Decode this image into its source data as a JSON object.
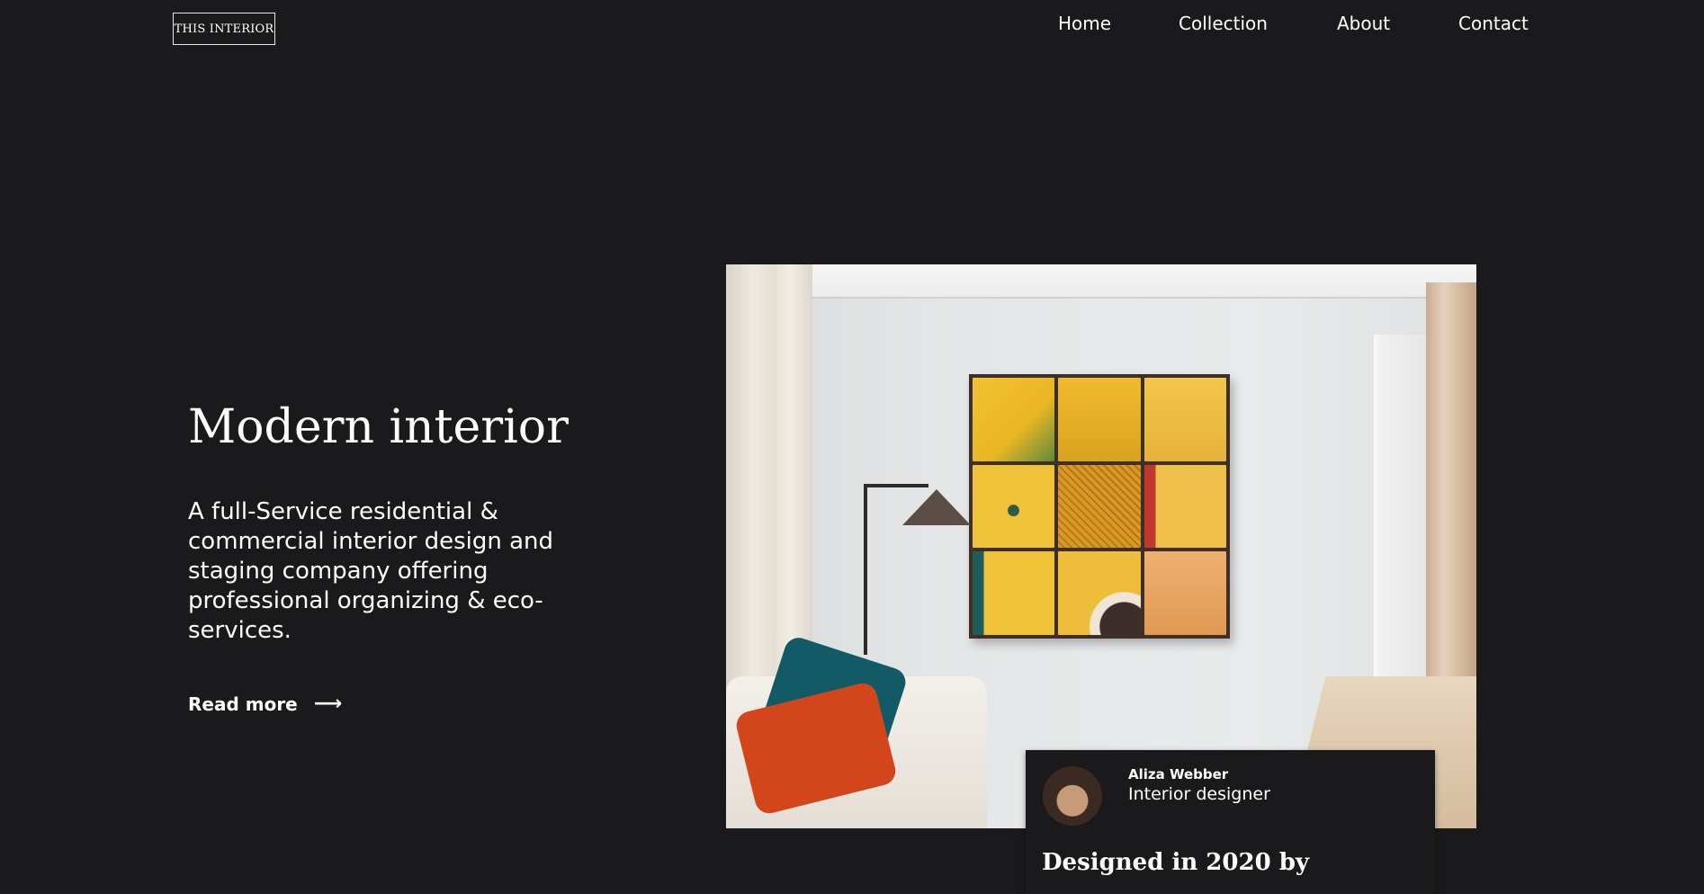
{
  "header": {
    "logo_text": "THIS INTERIOR",
    "nav": [
      {
        "label": "Home"
      },
      {
        "label": "Collection"
      },
      {
        "label": "About"
      },
      {
        "label": "Contact"
      }
    ]
  },
  "hero": {
    "title": "Modern interior",
    "description": "A full-Service residential & commercial interior design and staging company offering professional organizing & eco-services.",
    "cta_label": "Read more",
    "cta_icon": "arrow-right-icon"
  },
  "designer_card": {
    "name": "Aliza Webber",
    "role": "Interior designer",
    "heading": "Designed in 2020 by"
  },
  "colors": {
    "background": "#1a191b",
    "text": "#ffffff"
  }
}
